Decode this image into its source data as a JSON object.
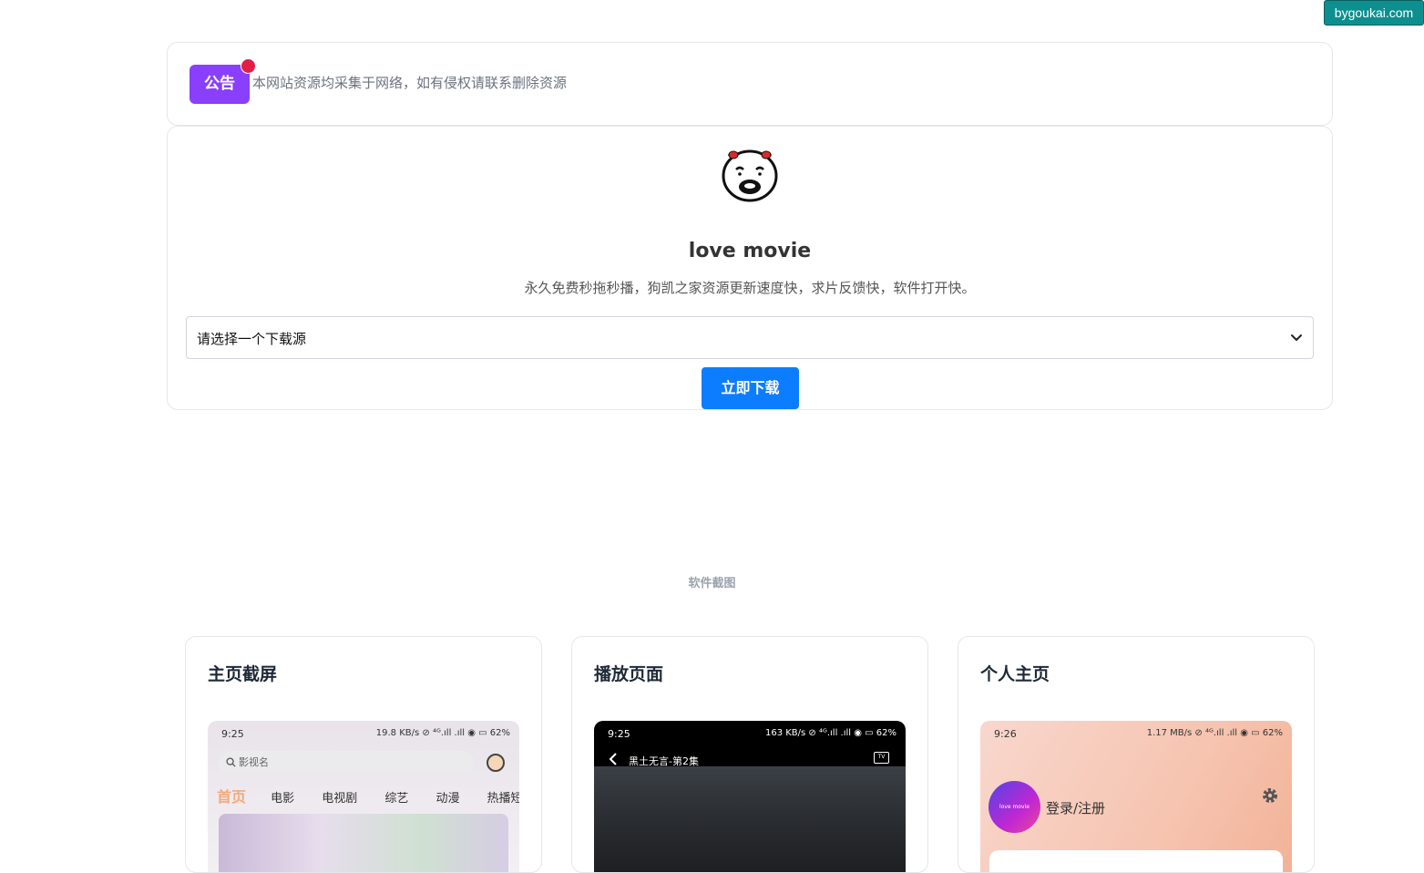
{
  "watermark": "bygoukai.com",
  "notice": {
    "tag": "公告",
    "text": "本网站资源均采集于网络，如有侵权请联系删除资源"
  },
  "hero": {
    "title": "love movie",
    "description": "永久免费秒拖秒播，狗凯之家资源更新速度快，求片反馈快，软件打开快。",
    "select_placeholder": "请选择一个下载源",
    "download_label": "立即下载"
  },
  "screenshots": {
    "section_label": "软件截图",
    "cards": [
      {
        "title": "主页截屏",
        "phone": {
          "time": "9:25",
          "status_right": "19.8 KB/s ⊘ ⁴ᴳ.ıll .ıll ◉ ▭ 62%",
          "search_placeholder": "影视名",
          "tabs": [
            "首页",
            "电影",
            "电视剧",
            "综艺",
            "动漫",
            "热播短视"
          ]
        }
      },
      {
        "title": "播放页面",
        "phone": {
          "time": "9:25",
          "status_right": "163 KB/s ⊘ ⁴ᴳ.ıll .ıll ◉ ▭ 62%",
          "video_title": "黑土无言-第2集",
          "tv_label": "TV"
        }
      },
      {
        "title": "个人主页",
        "phone": {
          "time": "9:26",
          "status_right": "1.17 MB/s ⊘ ⁴ᴳ.ıll .ıll ◉ ▭ 62%",
          "avatar_text": "love movie",
          "login_label": "登录/注册"
        }
      }
    ]
  },
  "colors": {
    "notice_tag": "#8a3ffc",
    "notice_dot": "#e11d48",
    "download_button": "#0d7dff"
  }
}
